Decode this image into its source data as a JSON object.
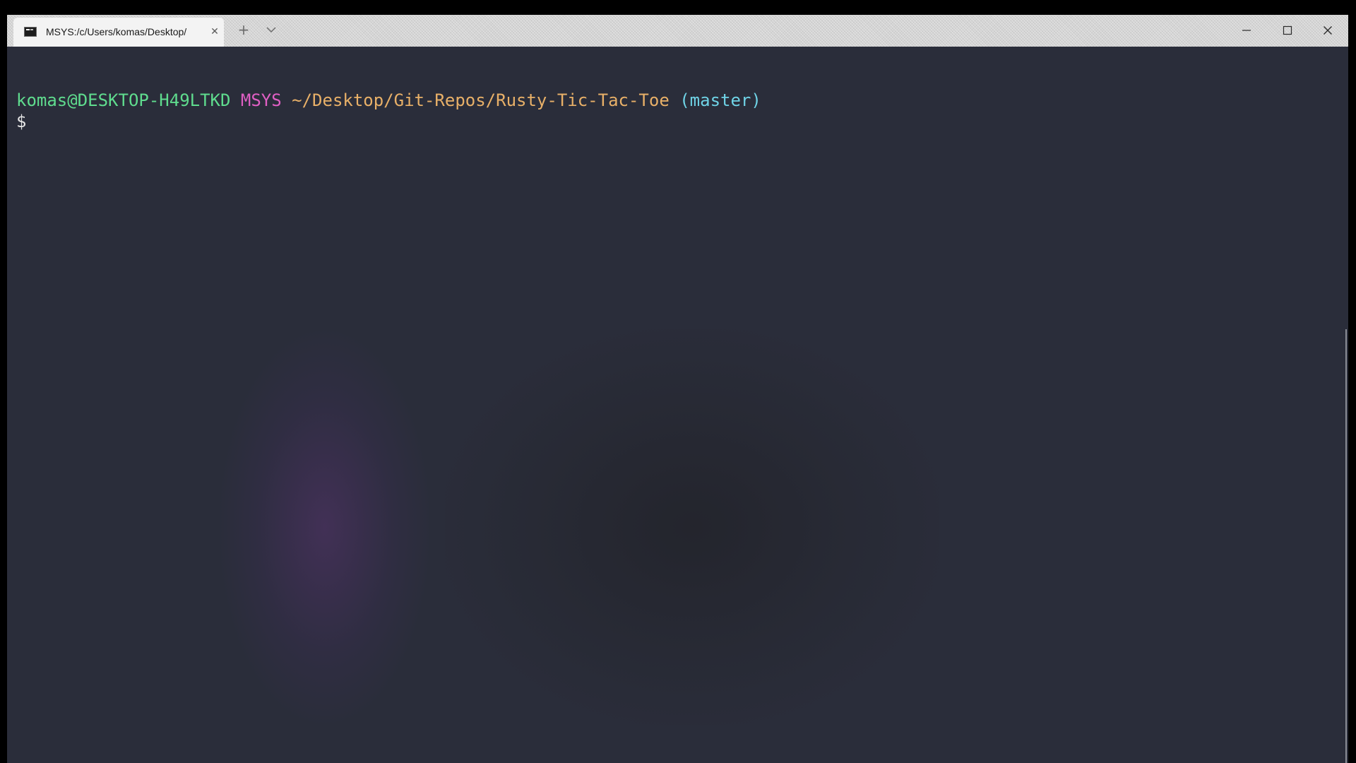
{
  "window": {
    "tab": {
      "title": "MSYS:/c/Users/komas/Desktop/",
      "icon": "terminal-icon",
      "close_icon": "close-icon"
    },
    "new_tab_symbol": "+",
    "controls": [
      "minimize-icon",
      "maximize-icon",
      "close-icon"
    ]
  },
  "terminal": {
    "prompt": {
      "user_host": "komas@DESKTOP-H49LTKD",
      "system": "MSYS",
      "path": "~/Desktop/Git-Repos/Rusty-Tic-Tac-Toe",
      "branch": "(master)",
      "symbol": "$"
    }
  },
  "colors": {
    "terminal_background": "#2a2d3a",
    "user_host": "#5fdc8e",
    "system": "#e05fc4",
    "path": "#e8b068",
    "branch": "#6fd3e6",
    "prompt_symbol": "#e6e6e6"
  }
}
